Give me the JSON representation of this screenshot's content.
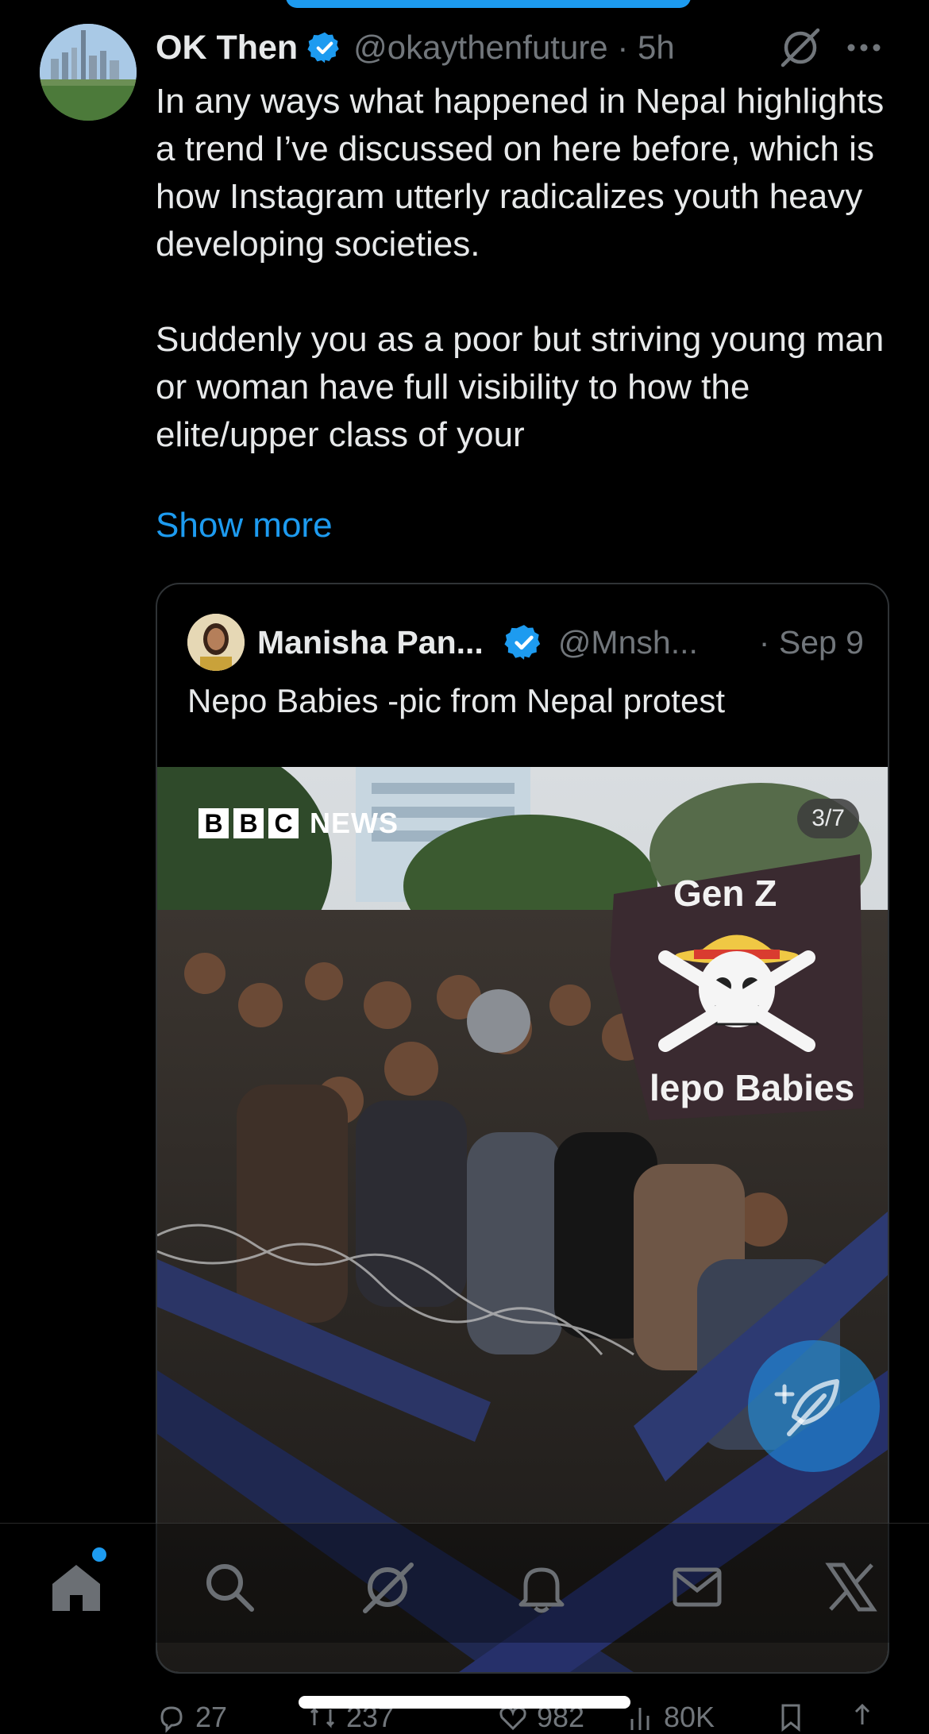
{
  "tweet": {
    "author_name": "OK Then",
    "handle_time": "@okaythenfuture · 5h",
    "text": "In any ways what happened in Nepal highlights a trend I’ve discussed on here before, which is how Instagram utterly radicalizes youth heavy developing societies.\n\nSuddenly you as a poor but striving young man or woman have full visibility to how the elite/upper class of your",
    "show_more": "Show more"
  },
  "quote": {
    "author_name": "Manisha Pan...",
    "handle": "@Mnsh...",
    "date": "· Sep 9",
    "text": "Nepo Babies -pic from Nepal protest",
    "photo": {
      "bbc_letters": [
        "B",
        "B",
        "C"
      ],
      "bbc_news": "NEWS",
      "counter": "3/7",
      "banner_top": "Gen Z",
      "banner_bottom": "lepo Babies"
    }
  },
  "actions": {
    "replies": "27",
    "reposts": "237",
    "likes": "982",
    "views": "80K"
  },
  "nav": {
    "items": [
      "home-icon",
      "search-icon",
      "grok-icon",
      "notifications-icon",
      "messages-icon",
      "x-icon"
    ]
  },
  "colors": {
    "accent": "#1d9bf0",
    "secondary_text": "#71767b",
    "primary_text": "#e7e9ea"
  }
}
